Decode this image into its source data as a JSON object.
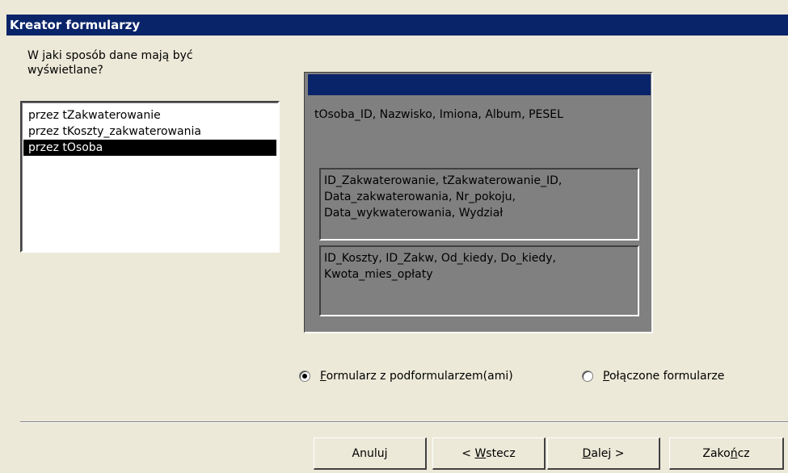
{
  "window": {
    "title": "Kreator formularzy"
  },
  "prompt": "W jaki sposób dane mają być\nwyświetlane?",
  "list": {
    "items": [
      {
        "label": "przez tZakwaterowanie",
        "selected": false
      },
      {
        "label": "przez tKoszty_zakwaterowania",
        "selected": false
      },
      {
        "label": "przez tOsoba",
        "selected": true
      }
    ]
  },
  "preview": {
    "main_fields": "tOsoba_ID, Nazwisko, Imiona, Album, PESEL",
    "subform1_fields": "ID_Zakwaterowanie, tZakwaterowanie_ID, Data_zakwaterowania, Nr_pokoju, Data_wykwaterowania, Wydział",
    "subform2_fields": "ID_Koszty, ID_Zakw, Od_kiedy, Do_kiedy, Kwota_mies_opłaty"
  },
  "options": {
    "subform": {
      "label_u": "F",
      "label_rest": "ormularz z podformularzem(ami)",
      "checked": true
    },
    "linked": {
      "label_u": "P",
      "label_rest": "ołączone formularze",
      "checked": false
    }
  },
  "buttons": {
    "cancel": "Anuluj",
    "back_pre": "< ",
    "back_u": "W",
    "back_rest": "stecz",
    "next_u": "D",
    "next_rest": "alej >",
    "finish_pre": "Zako",
    "finish_u": "ń",
    "finish_rest": "cz"
  }
}
